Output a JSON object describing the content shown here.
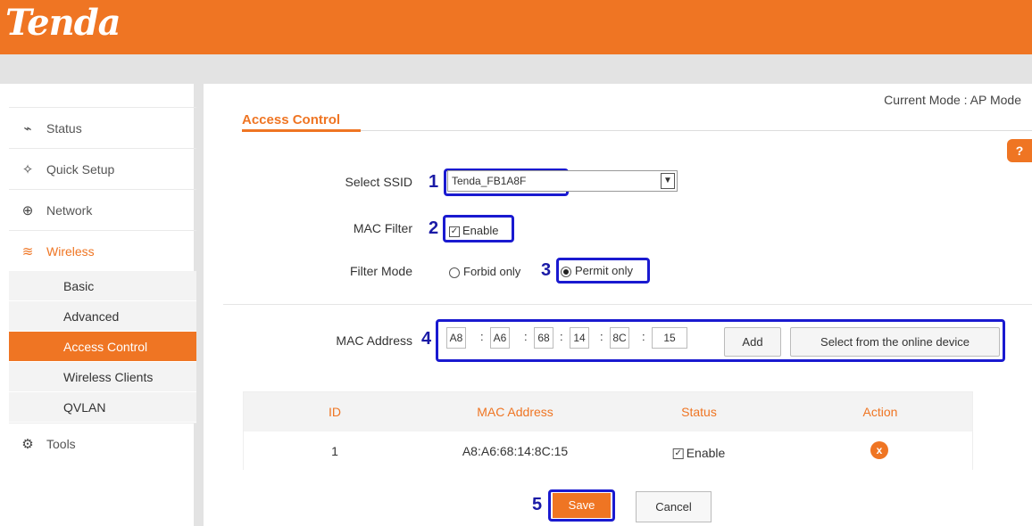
{
  "brand": {
    "logo": "Tenda",
    "color": "#ef7523"
  },
  "header": {
    "mode": "Current Mode : AP Mode"
  },
  "sidebar": {
    "items": [
      {
        "label": "Status",
        "icon": "pulse-icon"
      },
      {
        "label": "Quick Setup",
        "icon": "bolt-icon"
      },
      {
        "label": "Network",
        "icon": "globe-icon"
      },
      {
        "label": "Wireless",
        "icon": "wifi-icon",
        "active": true
      },
      {
        "label": "Tools",
        "icon": "gears-icon"
      }
    ],
    "wireless_sub": [
      {
        "label": "Basic"
      },
      {
        "label": "Advanced"
      },
      {
        "label": "Access Control",
        "active": true
      },
      {
        "label": "Wireless Clients"
      },
      {
        "label": "QVLAN"
      }
    ]
  },
  "page": {
    "title": "Access Control",
    "help": "?",
    "select_ssid_label": "Select SSID",
    "ssid_value": "Tenda_FB1A8F",
    "mac_filter_label": "MAC Filter",
    "mac_filter_enable": "Enable",
    "filter_mode_label": "Filter Mode",
    "forbid_only": "Forbid only",
    "permit_only": "Permit only",
    "filter_mode_selected": "Permit only",
    "mac_address_label": "MAC Address",
    "mac_parts": [
      "A8",
      "A6",
      "68",
      "14",
      "8C",
      "15"
    ],
    "mac_sep": ":",
    "add_button": "Add",
    "select_online_button": "Select from the online device",
    "annotations": [
      "1",
      "2",
      "3",
      "4",
      "5"
    ]
  },
  "table": {
    "headers": [
      "ID",
      "MAC Address",
      "Status",
      "Action"
    ],
    "rows": [
      {
        "id": "1",
        "mac": "A8:A6:68:14:8C:15",
        "status": "Enable",
        "action_icon": "x"
      }
    ]
  },
  "footer": {
    "save": "Save",
    "cancel": "Cancel"
  },
  "colors": {
    "accent": "#ef7523",
    "annotation": "#1a1ad0"
  }
}
